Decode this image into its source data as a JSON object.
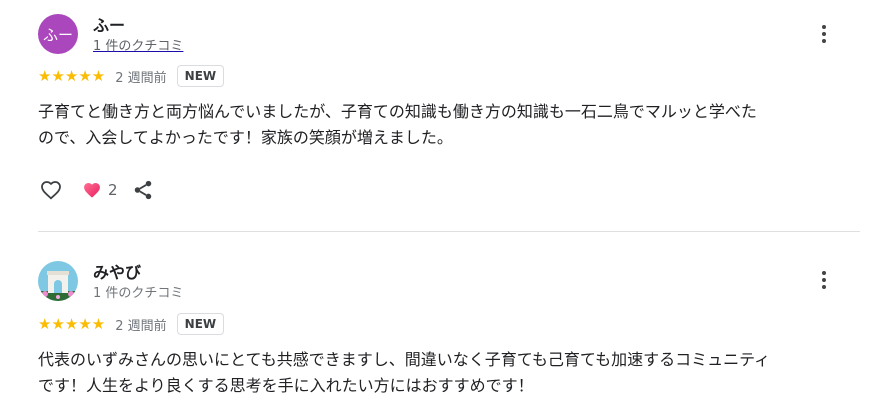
{
  "reviews": [
    {
      "avatar_text": "ふー",
      "name": "ふー",
      "meta": "1 件のクチコミ",
      "stars": "★★★★★",
      "date": "2 週間前",
      "badge": "NEW",
      "text": "子育てと働き方と両方悩んでいましたが、子育ての知識も働き方の知識も一石二鳥でマルッと学べた\nので、入会してよかったです！家族の笑顔が増えました。",
      "reaction_count": "2"
    },
    {
      "name": "みやび",
      "meta": "1 件のクチコミ",
      "stars": "★★★★★",
      "date": "2 週間前",
      "badge": "NEW",
      "text": "代表のいずみさんの思いにとても共感できますし、間違いなく子育ても己育ても加速するコミュニティ\nです！人生をより良くする思考を手に入れたい方にはおすすめです！"
    }
  ],
  "colors": {
    "star": "#fbbc04",
    "avatar_bg": "#ab47bc",
    "heart": "#e91e63"
  }
}
